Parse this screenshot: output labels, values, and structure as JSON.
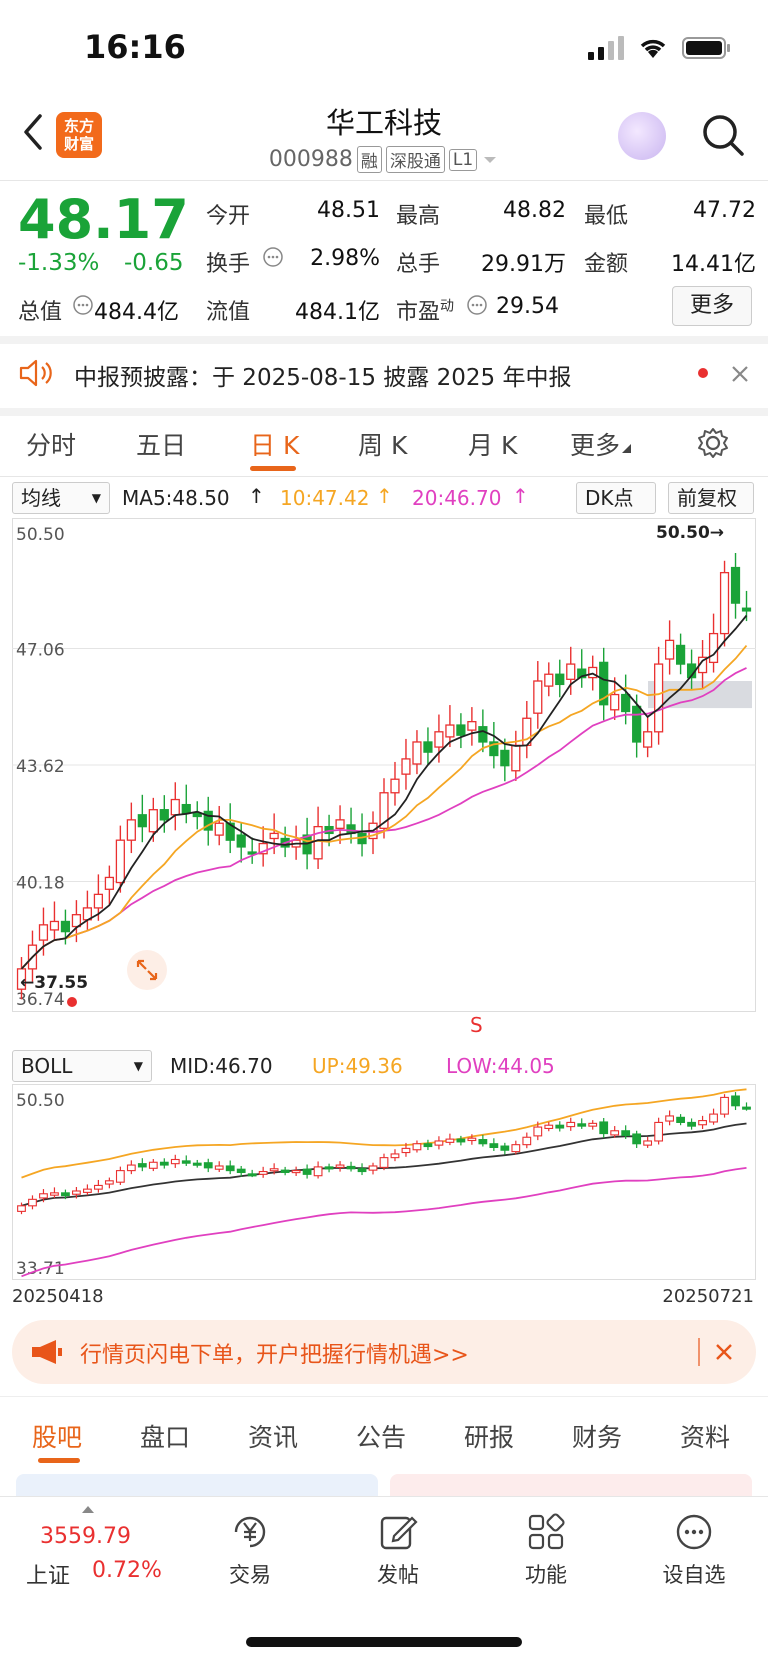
{
  "status": {
    "time": "16:16"
  },
  "header": {
    "logo_line1": "东方",
    "logo_line2": "财富",
    "stock_name": "华工科技",
    "stock_code": "000988",
    "tags": [
      "融",
      "深股通",
      "L1"
    ]
  },
  "quote": {
    "price": "48.17",
    "change_pct": "-1.33%",
    "change": "-0.65",
    "open_label": "今开",
    "open": "48.51",
    "high_label": "最高",
    "high": "48.82",
    "low_label": "最低",
    "low": "47.72",
    "turnover_label": "换手",
    "turnover": "2.98%",
    "volume_label": "总手",
    "volume": "29.91万",
    "amount_label": "金额",
    "amount": "14.41亿",
    "mktcap_label": "总值",
    "mktcap": "484.4亿",
    "float_label": "流值",
    "float_cap": "484.1亿",
    "pe_label": "市盈",
    "pe_sup": "动",
    "pe": "29.54",
    "more": "更多"
  },
  "notice": {
    "text": "中报预披露：于 2025-08-15 披露 2025 年中报"
  },
  "chart_tabs": [
    "分时",
    "五日",
    "日 K",
    "周 K",
    "月 K",
    "更多"
  ],
  "chart_tabs_active": 2,
  "main_chart": {
    "indicator": "均线",
    "ma5": "MA5:48.50",
    "ma10": "10:47.42",
    "ma20": "20:46.70",
    "dk": "DK点",
    "adjust": "前复权",
    "y_labels": [
      "50.50",
      "47.06",
      "43.62",
      "40.18",
      "36.74"
    ],
    "max_marker": "50.50→",
    "min_marker": "←37.55",
    "signal": "S"
  },
  "boll_chart": {
    "indicator": "BOLL",
    "mid": "MID:46.70",
    "up": "UP:49.36",
    "low": "LOW:44.05",
    "y_top": "50.50",
    "y_bottom": "33.71",
    "date_start": "20250418",
    "date_end": "20250721"
  },
  "chart_data": {
    "type": "candlestick",
    "x_start": "20250418",
    "x_end": "20250721",
    "ylim": [
      36.74,
      50.5
    ],
    "closes": [
      37.6,
      38.3,
      38.9,
      39.0,
      38.7,
      39.2,
      39.4,
      39.8,
      40.3,
      41.4,
      42.0,
      41.8,
      42.3,
      42.0,
      42.6,
      42.2,
      42.1,
      41.7,
      41.9,
      41.4,
      41.2,
      41.0,
      41.3,
      41.6,
      41.2,
      41.4,
      41.0,
      41.8,
      41.6,
      42.0,
      41.6,
      41.3,
      41.9,
      42.8,
      43.2,
      43.8,
      44.3,
      44.0,
      44.6,
      44.8,
      44.5,
      44.9,
      44.3,
      43.9,
      43.6,
      44.2,
      45.0,
      46.1,
      46.3,
      46.0,
      46.6,
      46.2,
      46.5,
      45.4,
      45.7,
      45.2,
      44.3,
      44.6,
      46.6,
      47.3,
      46.6,
      46.2,
      46.8,
      47.5,
      49.3,
      48.4,
      48.17
    ],
    "ma5_last": 48.5,
    "ma10_last": 47.42,
    "ma20_last": 46.7,
    "boll": {
      "mid": 46.7,
      "up": 49.36,
      "low": 44.05,
      "ylim": [
        33.71,
        50.5
      ]
    },
    "colors": {
      "up": "#e93030",
      "down": "#1aa338",
      "ma5": "#222222",
      "ma10": "#f5a623",
      "ma20": "#e040c0"
    }
  },
  "banner": {
    "text": "行情页闪电下单，开户把握行情机遇>>"
  },
  "bottom_tabs": [
    "股吧",
    "盘口",
    "资讯",
    "公告",
    "研报",
    "财务",
    "资料"
  ],
  "bottom_tabs_active": 0,
  "nav": {
    "index_value": "3559.79",
    "index_name": "上证",
    "index_change": "0.72%",
    "items": [
      "交易",
      "发帖",
      "功能",
      "设自选"
    ]
  }
}
